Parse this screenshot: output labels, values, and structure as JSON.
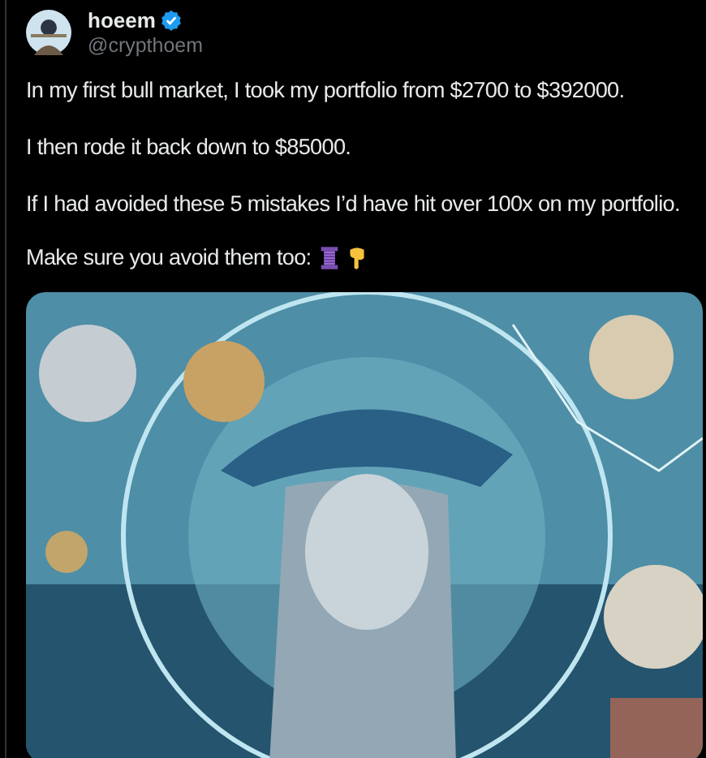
{
  "author": {
    "name": "hoeem",
    "verified": true,
    "handle": "@crypthoem"
  },
  "paragraphs": [
    "In my first bull market, I took my portfolio from $2700 to $392000.",
    "I then rode it back down to $85000.",
    "If I had avoided these 5 mistakes I’d have hit over 100x on my portfolio.",
    "Make sure you avoid them too:"
  ]
}
